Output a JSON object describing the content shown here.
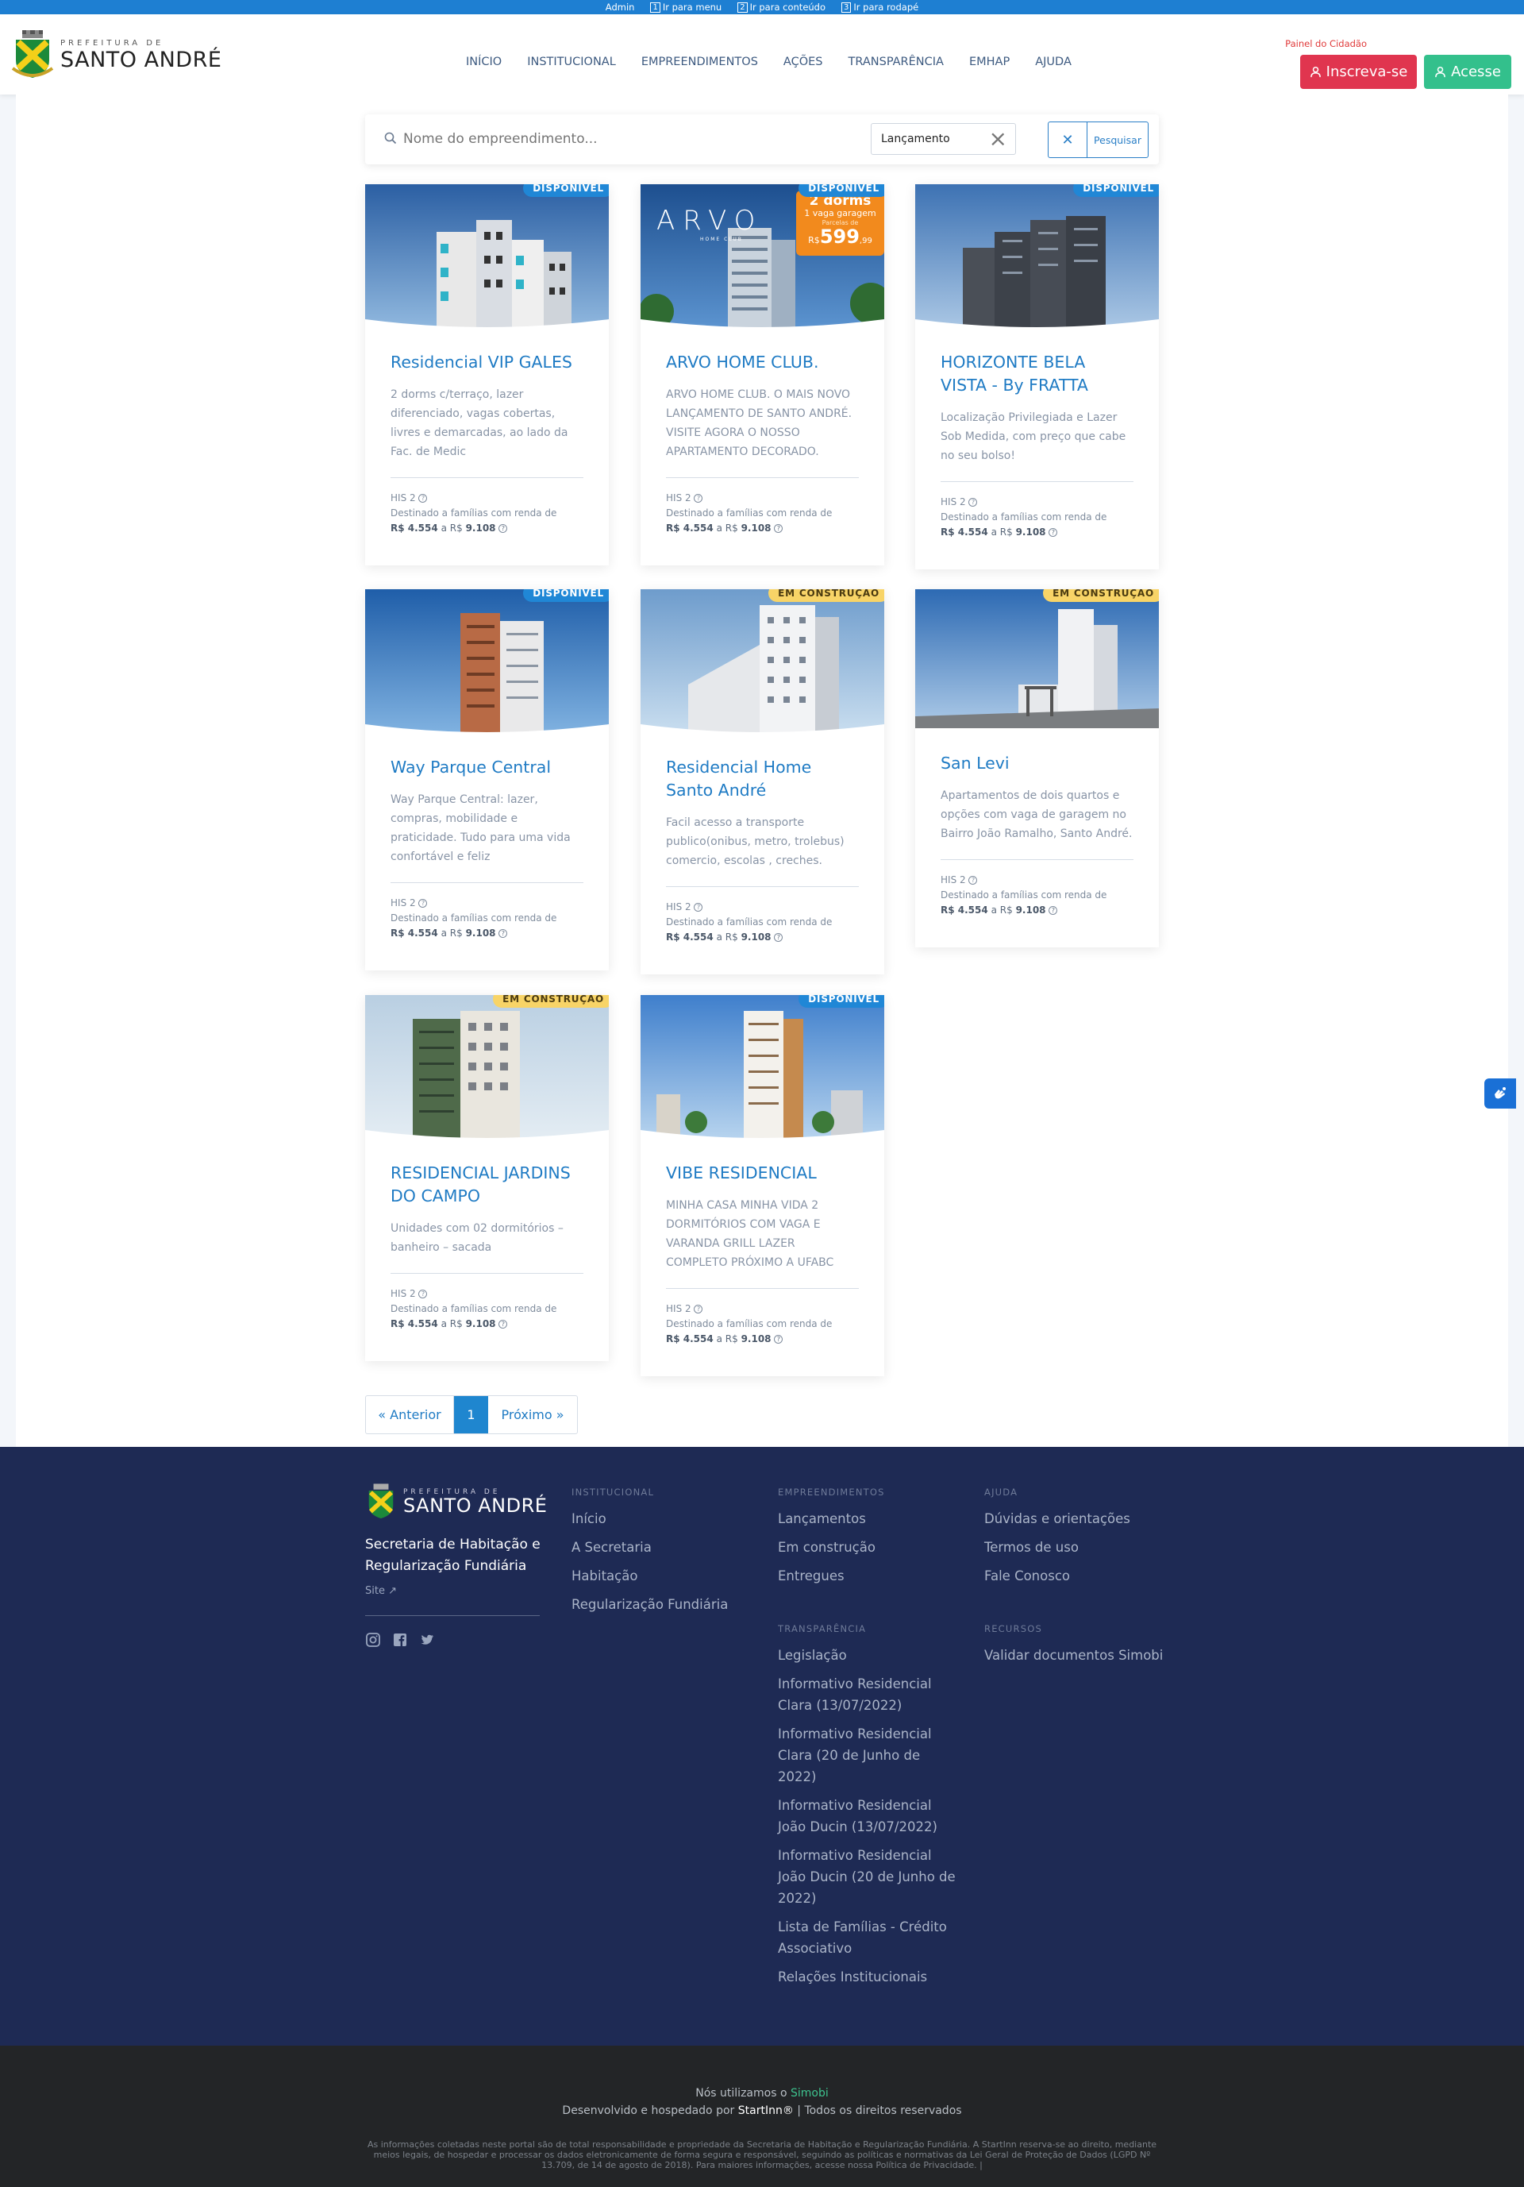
{
  "topbar": {
    "admin": "Admin",
    "skip_menu": "Ir para menu",
    "skip_content": "Ir para conteúdo",
    "skip_footer": "Ir para rodapé",
    "n1": "1",
    "n2": "2",
    "n3": "3"
  },
  "logo": {
    "small": "PREFEITURA DE",
    "big": "SANTO ANDRÉ"
  },
  "nav": {
    "items": [
      "INÍCIO",
      "INSTITUCIONAL",
      "EMPREENDIMENTOS",
      "AÇÕES",
      "TRANSPARÊNCIA",
      "EMHAP",
      "AJUDA"
    ]
  },
  "header": {
    "painel": "Painel do Cidadão",
    "inscreva": "Inscreva-se",
    "acesse": "Acesse"
  },
  "search": {
    "placeholder": "Nome do empreendimento...",
    "filter": "Lançamento",
    "search_label": "Pesquisar"
  },
  "cards": [
    {
      "title": "Residencial VIP GALES",
      "status": "DISPONÍVEL",
      "desc": "2 dorms c/terraço, lazer diferenciado, vagas cobertas, livres e demarcadas, ao lado da Fac. de Medic",
      "his": "HIS 2",
      "renda": "Destinado a famílias com renda de",
      "min": "R$ 4.554",
      "a": "a",
      "rs": "R$",
      "max": "9.108"
    },
    {
      "title": "ARVO HOME CLUB.",
      "status": "DISPONÍVEL",
      "desc": "ARVO HOME CLUB. O MAIS NOVO LANÇAMENTO DE SANTO ANDRÉ. VISITE AGORA O NOSSO APARTAMENTO DECORADO.",
      "his": "HIS 2",
      "renda": "Destinado a famílias com renda de",
      "min": "R$ 4.554",
      "a": "a",
      "rs": "R$",
      "max": "9.108",
      "promo": {
        "brand": "ARVO",
        "brand_sub": "HOME CLUB",
        "dorms": "2 dorms",
        "vaga": "1 vaga garagem",
        "parcelas": "Parcelas de",
        "rs": "R$",
        "price": "599",
        "cents": ",99"
      }
    },
    {
      "title": "HORIZONTE BELA VISTA - By FRATTA",
      "status": "DISPONÍVEL",
      "desc": "Localização Privilegiada e Lazer Sob Medida, com preço que cabe no seu bolso!",
      "his": "HIS 2",
      "renda": "Destinado a famílias com renda de",
      "min": "R$ 4.554",
      "a": "a",
      "rs": "R$",
      "max": "9.108"
    },
    {
      "title": "Way Parque Central",
      "status": "DISPONÍVEL",
      "desc": "Way Parque Central: lazer, compras, mobilidade e praticidade. Tudo para uma vida confortável e feliz",
      "his": "HIS 2",
      "renda": "Destinado a famílias com renda de",
      "min": "R$ 4.554",
      "a": "a",
      "rs": "R$",
      "max": "9.108"
    },
    {
      "title": "Residencial Home Santo André",
      "status": "EM CONSTRUÇÃO",
      "desc": "Facil acesso a transporte publico(onibus, metro, trolebus) comercio, escolas , creches.",
      "his": "HIS 2",
      "renda": "Destinado a famílias com renda de",
      "min": "R$ 4.554",
      "a": "a",
      "rs": "R$",
      "max": "9.108"
    },
    {
      "title": "San Levi",
      "status": "EM CONSTRUÇÃO",
      "desc": "Apartamentos de dois quartos e opções com vaga de garagem no Bairro João Ramalho, Santo André.",
      "his": "HIS 2",
      "renda": "Destinado a famílias com renda de",
      "min": "R$ 4.554",
      "a": "a",
      "rs": "R$",
      "max": "9.108"
    },
    {
      "title": "RESIDENCIAL JARDINS DO CAMPO",
      "status": "EM CONSTRUÇÃO",
      "desc": "Unidades com 02 dormitórios – banheiro – sacada",
      "his": "HIS 2",
      "renda": "Destinado a famílias com renda de",
      "min": "R$ 4.554",
      "a": "a",
      "rs": "R$",
      "max": "9.108"
    },
    {
      "title": "VIBE RESIDENCIAL",
      "status": "DISPONÍVEL",
      "desc": "MINHA CASA MINHA VIDA 2 DORMITÓRIOS COM VAGA E VARANDA GRILL LAZER COMPLETO PRÓXIMO A UFABC",
      "his": "HIS 2",
      "renda": "Destinado a famílias com renda de",
      "min": "R$ 4.554",
      "a": "a",
      "rs": "R$",
      "max": "9.108"
    }
  ],
  "pager": {
    "prev": "« Anterior",
    "current": "1",
    "next": "Próximo »"
  },
  "footer": {
    "logo_small": "PREFEITURA DE",
    "logo_big": "SANTO ANDRÉ",
    "secretaria": "Secretaria de Habitação e Regularização Fundiária",
    "site": "Site",
    "institucional": {
      "heading": "INSTITUCIONAL",
      "items": [
        "Início",
        "A Secretaria",
        "Habitação",
        "Regularização Fundiária"
      ]
    },
    "empreendimentos": {
      "heading": "EMPREENDIMENTOS",
      "items": [
        "Lançamentos",
        "Em construção",
        "Entregues"
      ]
    },
    "ajuda": {
      "heading": "AJUDA",
      "items": [
        "Dúvidas e orientações",
        "Termos de uso",
        "Fale Conosco"
      ]
    },
    "transparencia": {
      "heading": "TRANSPARÊNCIA",
      "items": [
        "Legislação",
        "Informativo Residencial Clara (13/07/2022)",
        "Informativo Residencial Clara (20 de Junho de 2022)",
        "Informativo Residencial João Ducin (13/07/2022)",
        "Informativo Residencial João Ducin (20 de Junho de 2022)",
        "Lista de Famílias - Crédito Associativo",
        "Relações Institucionais"
      ]
    },
    "recursos": {
      "heading": "RECURSOS",
      "items": [
        "Validar documentos Simobi"
      ]
    }
  },
  "bottom": {
    "uses": "Nós utilizamos o",
    "simobi": "Simobi",
    "dev": "Desenvolvido e hospedado por",
    "startinn": "StartInn®",
    "rights": "| Todos os direitos reservados",
    "legal": "As informações coletadas neste portal são de total responsabilidade e propriedade da Secretaria de Habitação e Regularização Fundiária. A StartInn reserva-se ao direito, mediante meios legais, de hospedar e processar os dados eletronicamente de forma segura e responsável, seguindo as políticas e normativas da Lei Geral de Proteção de Dados (LGPD Nº 13.709, de 14 de agosto de 2018). Para maiores informações, acesse nossa Política de Privacidade. |"
  },
  "colors": {
    "primary": "#1f7bc4",
    "danger": "#e0354f",
    "success": "#33c08c",
    "footer": "#1e2a54",
    "available": "#2087d6",
    "construction": "#f8d467"
  }
}
